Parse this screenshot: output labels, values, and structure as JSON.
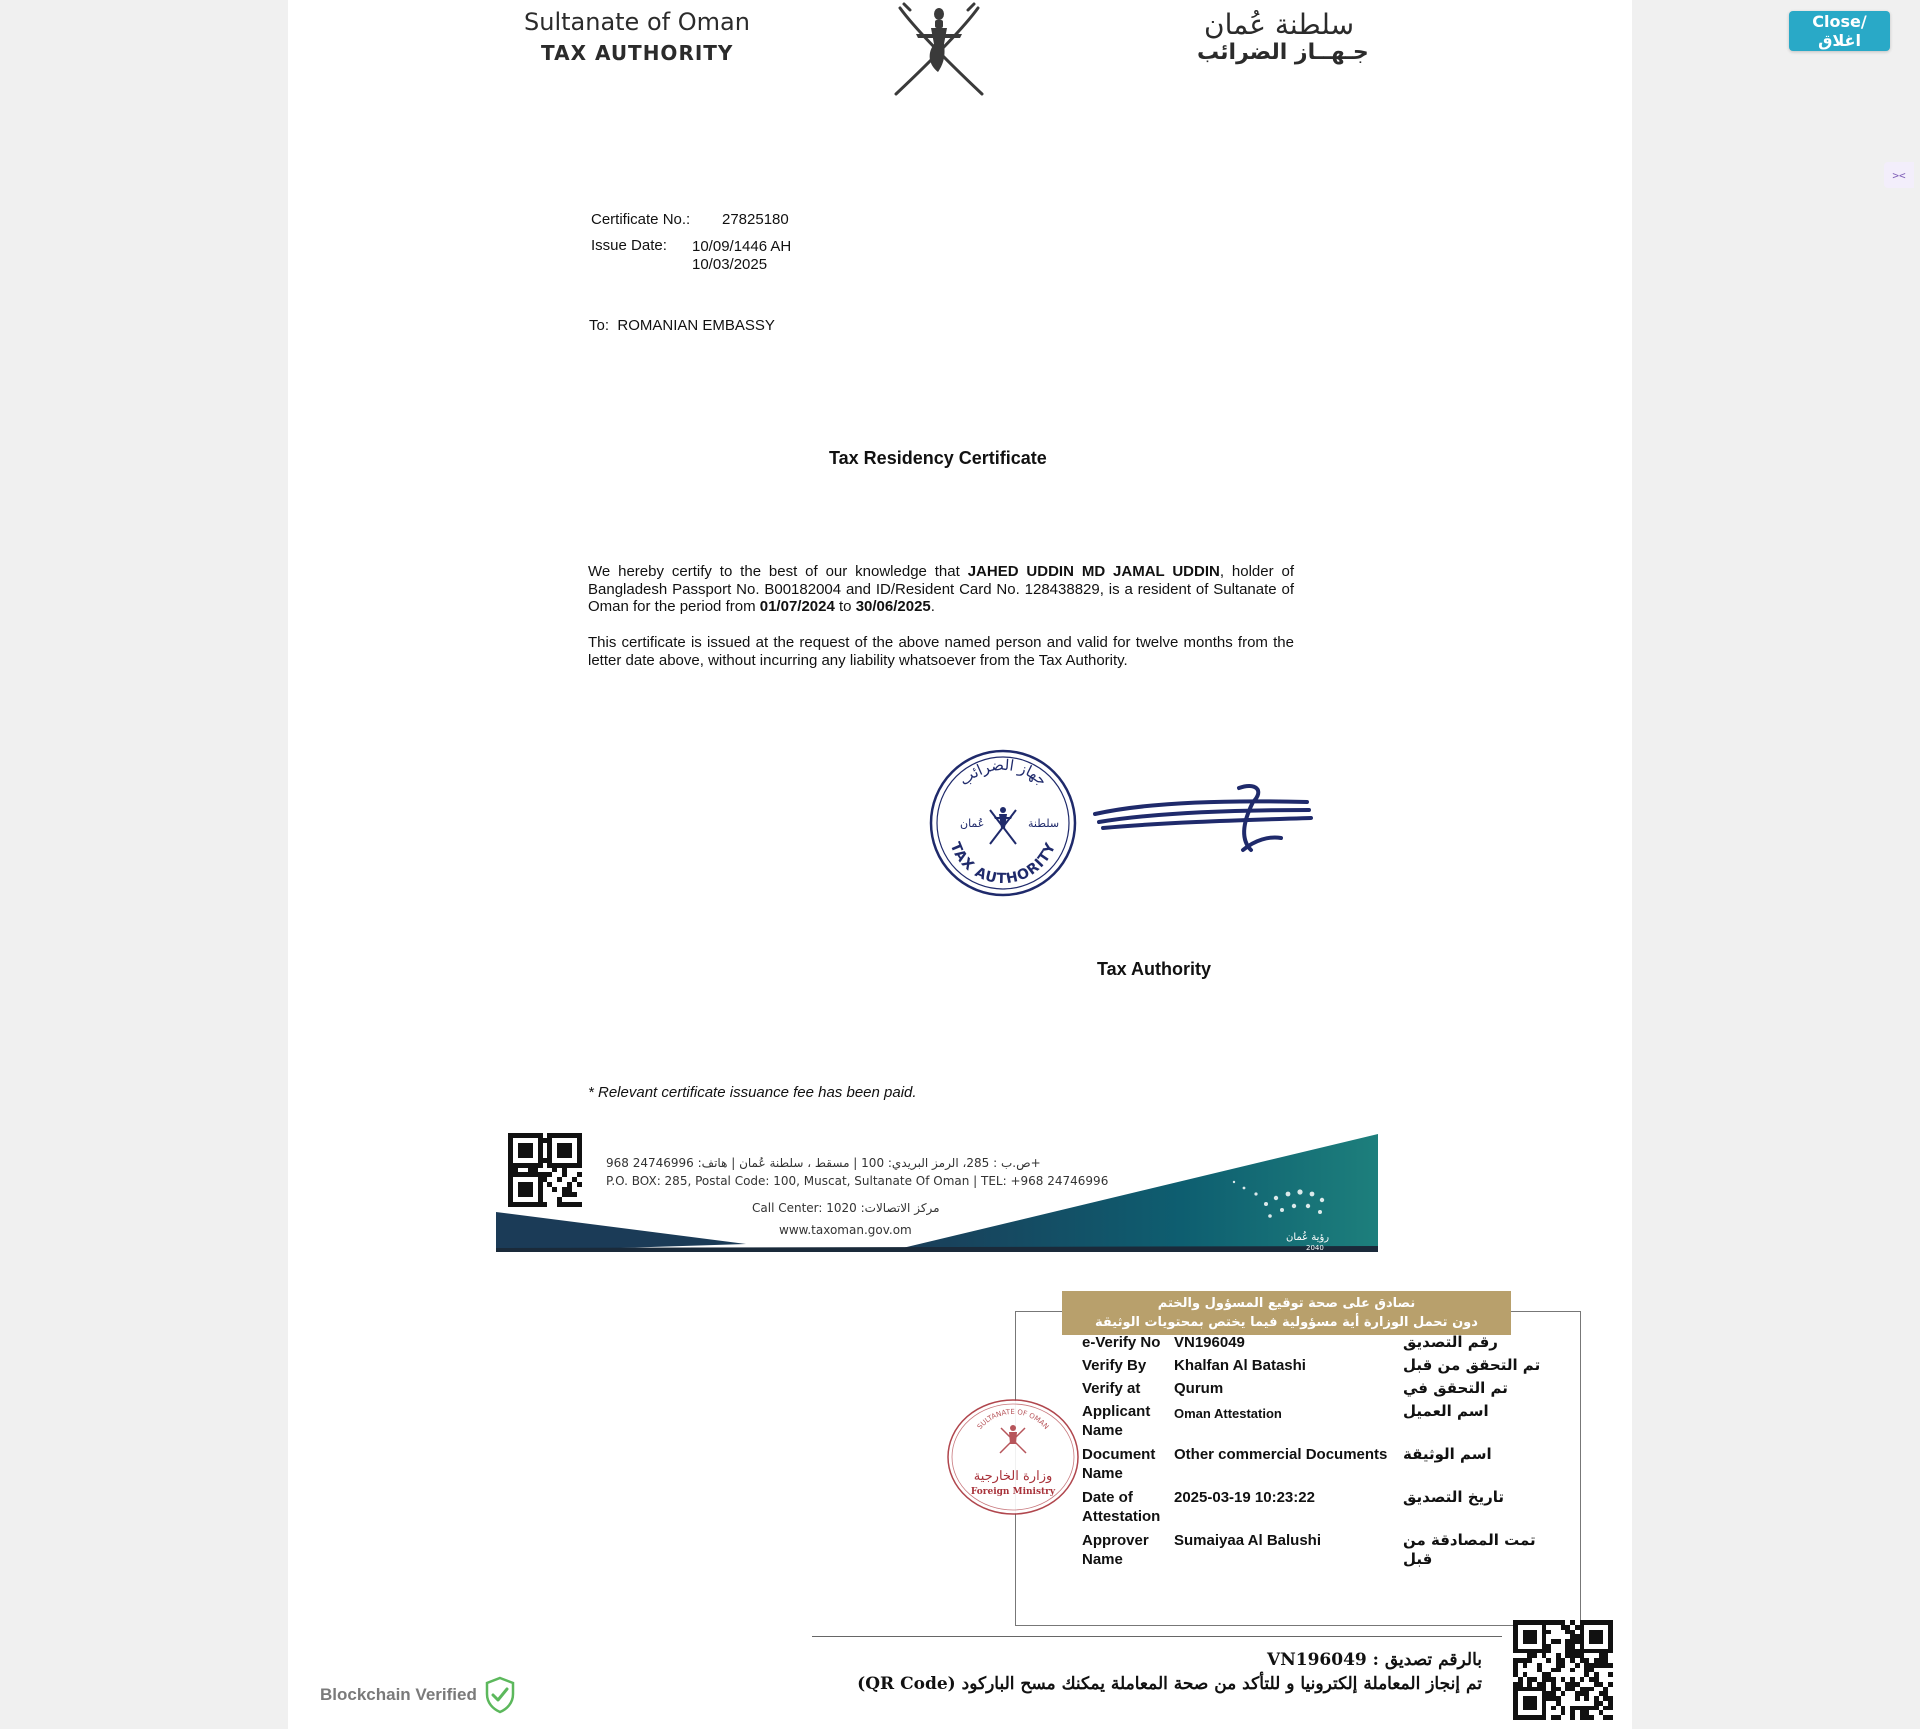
{
  "ui": {
    "close_label": "Close/اغلاق",
    "side_handle_icon": "expand-icon",
    "blockchain_label": "Blockchain Verified",
    "blockchain_icon": "shield-check-icon"
  },
  "certificate": {
    "header": {
      "en_line1": "Sultanate of Oman",
      "en_line2": "TAX AUTHORITY",
      "ar_line1": "سلطنة عُمان",
      "ar_line2": "جـهــاز الضرائب",
      "emblem_icon": "oman-khanjar-emblem"
    },
    "certificate_no_label": "Certificate No.:",
    "certificate_no": "27825180",
    "issue_date_label": "Issue Date:",
    "issue_date_hijri": "10/09/1446 AH",
    "issue_date_gregorian": "10/03/2025",
    "to_label": "To:",
    "to_value": "ROMANIAN EMBASSY",
    "title": "Tax Residency Certificate",
    "para1": {
      "intro": "We hereby certify to the best of our knowledge that ",
      "name": "JAHED UDDIN MD JAMAL UDDIN",
      "mid": ", holder of Bangladesh Passport No. B00182004 and ID/Resident Card No. 128438829, is a resident of Sultanate of Oman for the period from ",
      "from": "01/07/2024",
      "to_word": " to ",
      "to": "30/06/2025",
      "end": "."
    },
    "para2": "This certificate is issued at the request of the above named person and valid for twelve months from the letter date above, without incurring any liability whatsoever from the Tax Authority.",
    "stamp": {
      "top_ar": "جهاز الضرائب",
      "left_ar": "عُمان",
      "right_ar": "سلطنة",
      "bottom_en": "TAX AUTHORITY"
    },
    "signatory": "Tax Authority",
    "fee_note": "* Relevant certificate issuance fee has been paid.",
    "footer": {
      "address_ar": "ص.ب : 285، الرمز البريدي: 100 | مسقط ، سلطنة عُمان | هاتف: 24746996 968+",
      "address_en": "P.O. BOX: 285, Postal Code: 100, Muscat, Sultanate Of Oman | TEL: +968 24746996",
      "call_center": "Call Center: 1020 :مركز الاتصالات",
      "website": "www.taxoman.gov.om",
      "vision_ar": "رؤية عُمان",
      "vision_year": "2040"
    }
  },
  "attestation": {
    "banner_line1": "نصادق على صحة توقيع المسؤول والختم",
    "banner_line2": "دون تحمل الوزارة أية مسؤولية فيما يختص بمحتويات الوثيقة",
    "rows": [
      {
        "label": "e-Verify No",
        "value": "VN196049",
        "ar": "رقم التصديق"
      },
      {
        "label": "Verify By",
        "value": "Khalfan Al Batashi",
        "ar": "تم التحقق من قبل"
      },
      {
        "label": "Verify at",
        "value": "Qurum",
        "ar": "تم التحقق في"
      },
      {
        "label": "Applicant Name",
        "value": "Oman Attestation",
        "ar": "اسم العميل"
      },
      {
        "label": "Document Name",
        "value": "Other commercial Documents",
        "ar": "اسم الوثيقة"
      },
      {
        "label": "Date of Attestation",
        "value": "2025-03-19 10:23:22",
        "ar": "تاريخ التصديق"
      },
      {
        "label": "Approver Name",
        "value": "Sumaiyaa Al Balushi",
        "ar": "تمت المصادقة من قبل"
      }
    ],
    "seal_ar": "وزارة الخارجية",
    "seal_en": "Foreign Ministry",
    "seal_top": "SULTANATE OF OMAN",
    "bottom_line1": "بالرقم تصديق : VN196049",
    "bottom_line2": "تم إنجاز المعاملة إلكترونيا و للتأكد من صحة المعاملة يمكنك مسح الباركود (QR Code)"
  },
  "colors": {
    "close_button": "#29a9c7",
    "ink_blue": "#1f2a6b",
    "attest_gold": "#b8a06c",
    "seal_red": "#a8323a",
    "footer_teal": "#0d5a6a"
  }
}
